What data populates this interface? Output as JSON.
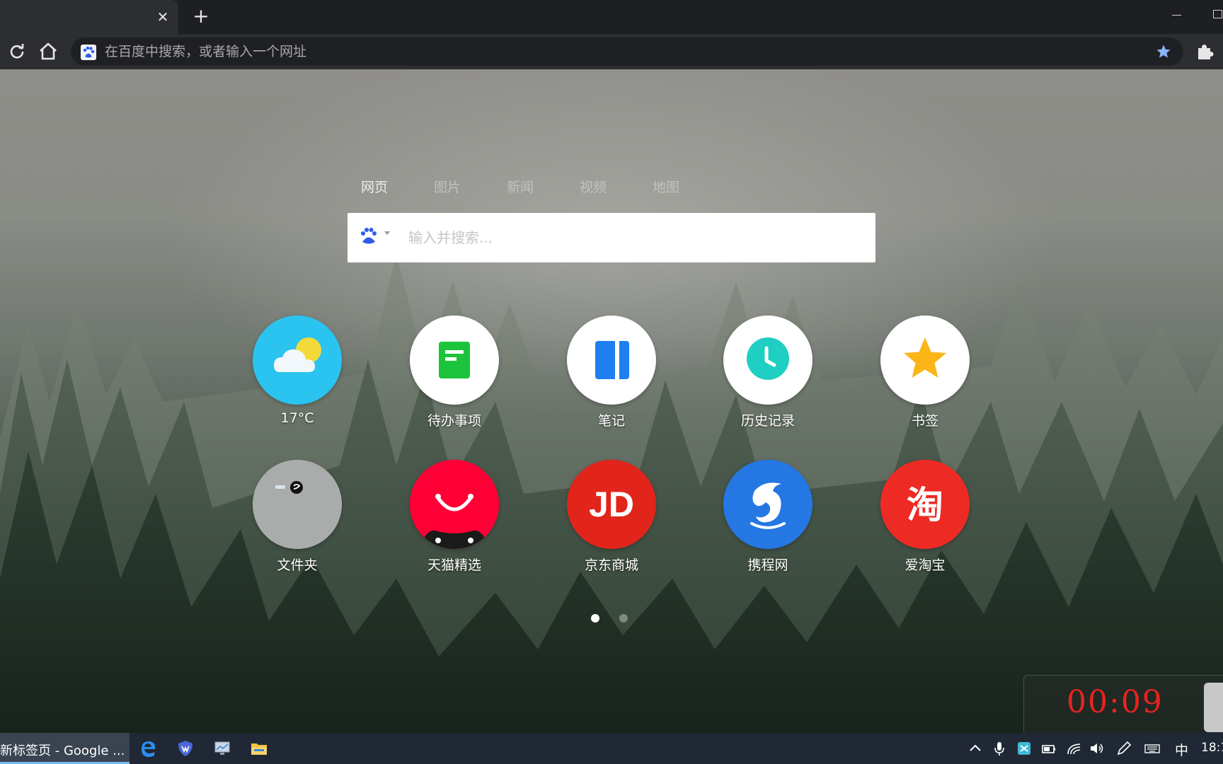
{
  "browser": {
    "tab": {
      "close_glyph": "✕"
    },
    "new_tab_glyph": "+",
    "omnibox": {
      "placeholder": "在百度中搜索，或者输入一个网址",
      "engine_icon": "baidu-paw-icon"
    },
    "bookmark_color": "#8ab4f8"
  },
  "newtab": {
    "search_tabs": [
      {
        "label": "网页",
        "active": true
      },
      {
        "label": "图片",
        "active": false
      },
      {
        "label": "新闻",
        "active": false
      },
      {
        "label": "视频",
        "active": false
      },
      {
        "label": "地图",
        "active": false
      }
    ],
    "search": {
      "placeholder": "输入并搜索...",
      "engine_icon": "baidu-paw-icon"
    },
    "tiles": [
      {
        "label": "17°C",
        "icon": "weather-icon",
        "color": "#2bc3f0"
      },
      {
        "label": "待办事项",
        "icon": "todo-icon",
        "color": "#1bc43a"
      },
      {
        "label": "笔记",
        "icon": "notes-icon",
        "color": "#1e7ff0"
      },
      {
        "label": "历史记录",
        "icon": "history-clock-icon",
        "color": "#1fcfc2"
      },
      {
        "label": "书签",
        "icon": "bookmark-star-icon",
        "color": "#fbb517"
      },
      {
        "label": "文件夹",
        "icon": "folder-icon",
        "color": "#a9acab"
      },
      {
        "label": "天猫精选",
        "icon": "tmall-icon",
        "color": "#ff0036"
      },
      {
        "label": "京东商城",
        "icon": "jd-icon",
        "color": "#e1251b",
        "glyph": "JD"
      },
      {
        "label": "携程网",
        "icon": "ctrip-dolphin-icon",
        "color": "#2577e3"
      },
      {
        "label": "爱淘宝",
        "icon": "taobao-icon",
        "color": "#ee2a24",
        "glyph": "淘"
      }
    ],
    "pages": {
      "count": 2,
      "current": 1
    },
    "timer": {
      "text": "00:09",
      "color": "#e8231f"
    }
  },
  "taskbar": {
    "active_window_label": "新标签页 - Google ...",
    "pinned": [
      "edge-icon",
      "shield-icon",
      "monitor-icon",
      "folder-icon"
    ],
    "tray": {
      "ime": "中",
      "clock": "18:1"
    }
  }
}
